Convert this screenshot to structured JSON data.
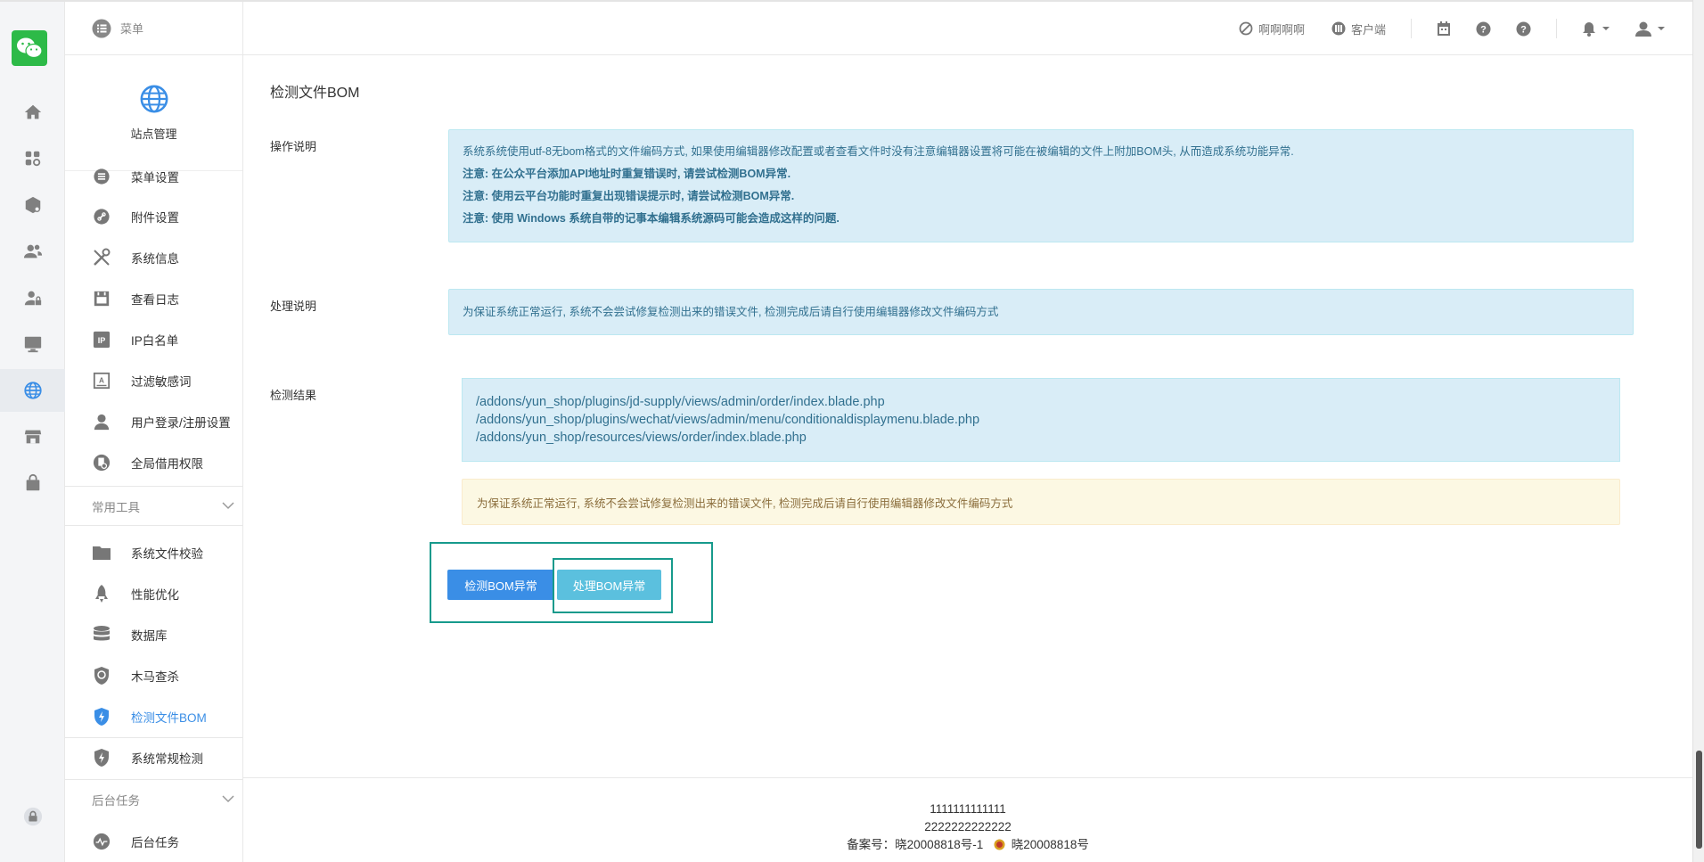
{
  "header": {
    "menu_label": "菜单",
    "link1": "啊啊啊啊",
    "link2": "客户端"
  },
  "subnav": {
    "site_title": "站点管理",
    "items": [
      {
        "label": "菜单设置"
      },
      {
        "label": "附件设置"
      },
      {
        "label": "系统信息"
      },
      {
        "label": "查看日志"
      },
      {
        "label": "IP白名单"
      },
      {
        "label": "过滤敏感词"
      },
      {
        "label": "用户登录/注册设置"
      },
      {
        "label": "全局借用权限"
      }
    ],
    "group_tools": "常用工具",
    "tools": [
      {
        "label": "系统文件校验"
      },
      {
        "label": "性能优化"
      },
      {
        "label": "数据库"
      },
      {
        "label": "木马查杀"
      },
      {
        "label": "检测文件BOM"
      },
      {
        "label": "系统常规检测"
      }
    ],
    "group_tasks": "后台任务",
    "tasks": [
      {
        "label": "后台任务"
      }
    ]
  },
  "main": {
    "page_title": "检测文件BOM",
    "op_label": "操作说明",
    "op_lines": [
      "系统系统使用utf-8无bom格式的文件编码方式, 如果使用编辑器修改配置或者查看文件时没有注意编辑器设置将可能在被编辑的文件上附加BOM头, 从而造成系统功能异常.",
      "注意: 在公众平台添加API地址时重复错误时, 请尝试检测BOM异常.",
      "注意: 使用云平台功能时重复出现错误提示时, 请尝试检测BOM异常.",
      "注意: 使用 Windows 系统自带的记事本编辑系统源码可能会造成这样的问题."
    ],
    "proc_label": "处理说明",
    "proc_text": "为保证系统正常运行, 系统不会尝试修复检测出来的错误文件, 检测完成后请自行使用编辑器修改文件编码方式",
    "result_label": "检测结果",
    "result_files": [
      "/addons/yun_shop/plugins/jd-supply/views/admin/order/index.blade.php",
      "/addons/yun_shop/plugins/wechat/views/admin/menu/conditionaldisplaymenu.blade.php",
      "/addons/yun_shop/resources/views/order/index.blade.php"
    ],
    "warn_text": "为保证系统正常运行, 系统不会尝试修复检测出来的错误文件, 检测完成后请自行使用编辑器修改文件编码方式",
    "btn_detect": "检测BOM异常",
    "btn_process": "处理BOM异常"
  },
  "footer": {
    "line1": "1111111111111",
    "line2": "2222222222222",
    "beian": "备案号：晓20008818号-1",
    "police": "晓20008818号"
  }
}
